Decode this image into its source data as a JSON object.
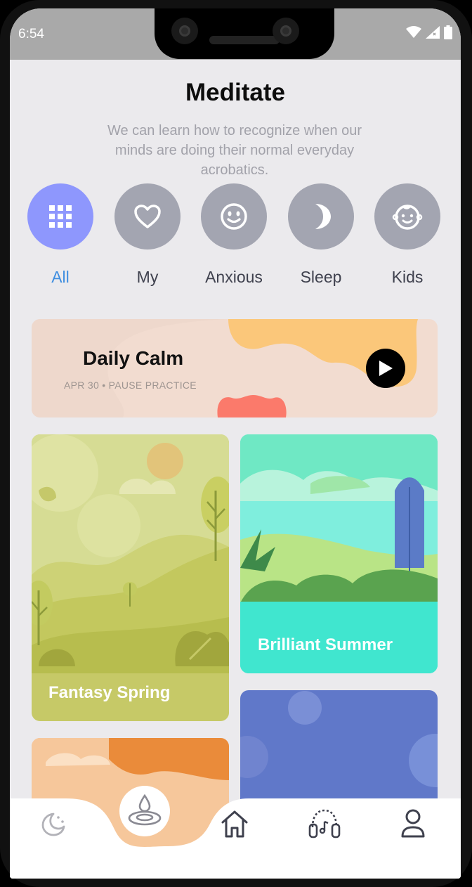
{
  "status": {
    "time": "6:54"
  },
  "header": {
    "title": "Meditate",
    "subtitle": "We can learn how to recognize when our minds are doing their normal everyday acrobatics."
  },
  "categories": [
    {
      "label": "All",
      "icon": "grid-icon",
      "active": true
    },
    {
      "label": "My",
      "icon": "heart-icon",
      "active": false
    },
    {
      "label": "Anxious",
      "icon": "smiley-icon",
      "active": false
    },
    {
      "label": "Sleep",
      "icon": "moon-icon",
      "active": false
    },
    {
      "label": "Kids",
      "icon": "baby-face-icon",
      "active": false
    }
  ],
  "daily": {
    "title": "Daily Calm",
    "subtitle": "APR 30 • PAUSE PRACTICE"
  },
  "cards": [
    {
      "label": "Fantasy Spring"
    },
    {
      "label": "Brilliant Summer"
    }
  ],
  "nav": [
    {
      "icon": "moon-stars-icon"
    },
    {
      "icon": "meditate-drop-icon",
      "active": true
    },
    {
      "icon": "home-icon"
    },
    {
      "icon": "headphones-icon"
    },
    {
      "icon": "profile-icon"
    }
  ],
  "colors": {
    "accent": "#8e97fd",
    "inactive_circle": "#a3a5b1",
    "active_label": "#3f8ee0"
  }
}
